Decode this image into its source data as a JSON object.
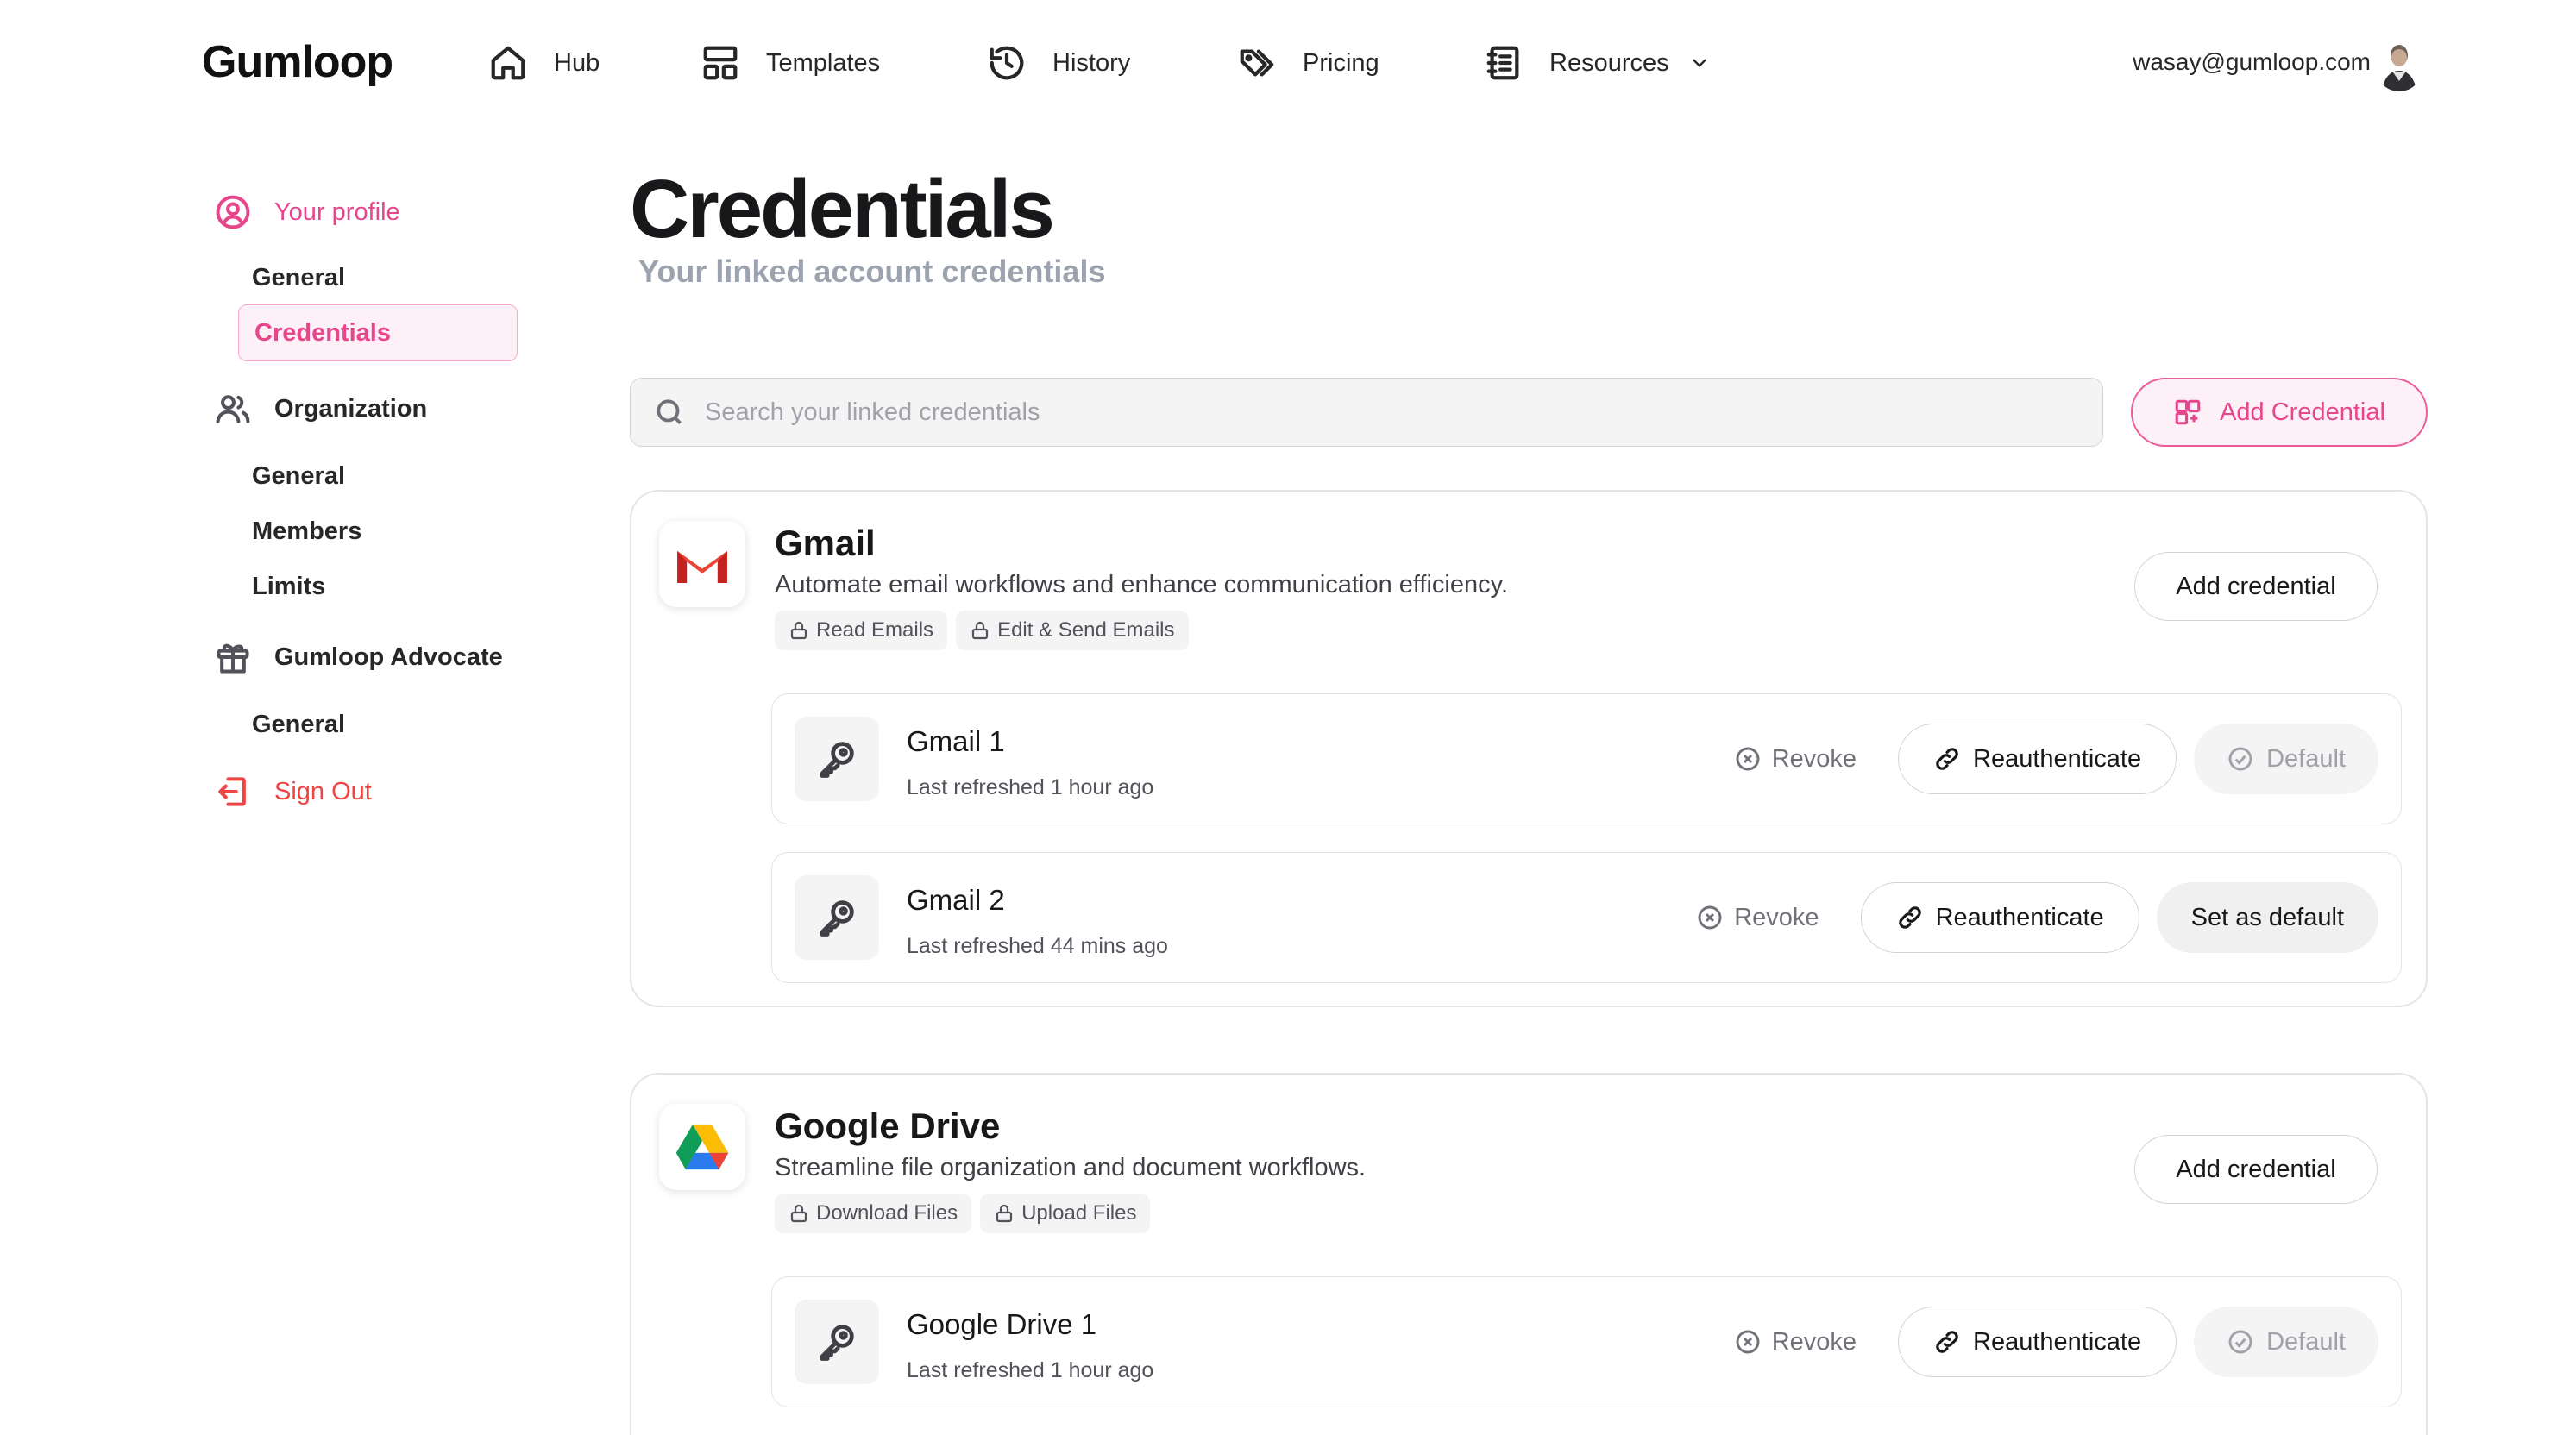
{
  "nav": {
    "logo": "Gumloop",
    "items": [
      {
        "label": "Hub",
        "icon": "home-icon"
      },
      {
        "label": "Templates",
        "icon": "templates-icon"
      },
      {
        "label": "History",
        "icon": "history-icon"
      },
      {
        "label": "Pricing",
        "icon": "tags-icon"
      },
      {
        "label": "Resources",
        "icon": "notebook-icon"
      }
    ],
    "user_email": "wasay@gumloop.com"
  },
  "sidebar": {
    "profile": {
      "label": "Your profile",
      "links": [
        "General",
        "Credentials"
      ]
    },
    "organization": {
      "label": "Organization",
      "links": [
        "General",
        "Members",
        "Limits"
      ]
    },
    "advocate": {
      "label": "Gumloop Advocate",
      "links": [
        "General"
      ]
    },
    "sign_out": "Sign Out"
  },
  "main": {
    "title": "Credentials",
    "subtitle": "Your linked account credentials",
    "search_placeholder": "Search your linked credentials",
    "add_credential": "Add Credential"
  },
  "colors": {
    "accent": "#e8468c",
    "accent_bg": "#fdf1f7"
  },
  "apps": [
    {
      "name": "Gmail",
      "description": "Automate email workflows and enhance communication efficiency.",
      "scopes": [
        "Read Emails",
        "Edit & Send Emails"
      ],
      "add_label": "Add credential",
      "credentials": [
        {
          "name": "Gmail 1",
          "refreshed": "Last refreshed 1 hour ago",
          "revoke": "Revoke",
          "reauth": "Reauthenticate",
          "default_label": "Default",
          "is_default": true
        },
        {
          "name": "Gmail 2",
          "refreshed": "Last refreshed 44 mins ago",
          "revoke": "Revoke",
          "reauth": "Reauthenticate",
          "default_label": "Set as default",
          "is_default": false
        }
      ]
    },
    {
      "name": "Google Drive",
      "description": "Streamline file organization and document workflows.",
      "scopes": [
        "Download Files",
        "Upload Files"
      ],
      "add_label": "Add credential",
      "credentials": [
        {
          "name": "Google Drive 1",
          "refreshed": "Last refreshed 1 hour ago",
          "revoke": "Revoke",
          "reauth": "Reauthenticate",
          "default_label": "Default",
          "is_default": true
        }
      ]
    }
  ]
}
